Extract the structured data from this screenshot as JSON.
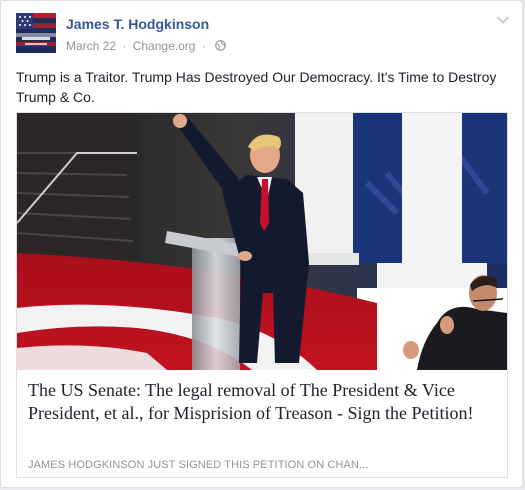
{
  "post": {
    "author": "James T. Hodgkinson",
    "date": "March 22",
    "source": "Change.org",
    "separator": "·",
    "privacy_icon": "globe-icon",
    "options_icon": "chevron-down-icon",
    "text": "Trump is a Traitor. Trump Has Destroyed Our Democracy. It's Time to Destroy Trump & Co."
  },
  "link_preview": {
    "title": "The US Senate: The legal removal of The President & Vice President, et al., for Misprision of Treason - Sign the Petition!",
    "caption": "JAMES HODGKINSON JUST SIGNED THIS PETITION ON CHAN..."
  },
  "colors": {
    "author_link": "#365899",
    "meta_text": "#90949c",
    "body_text": "#1d2129",
    "card_border": "#dddfe2"
  }
}
